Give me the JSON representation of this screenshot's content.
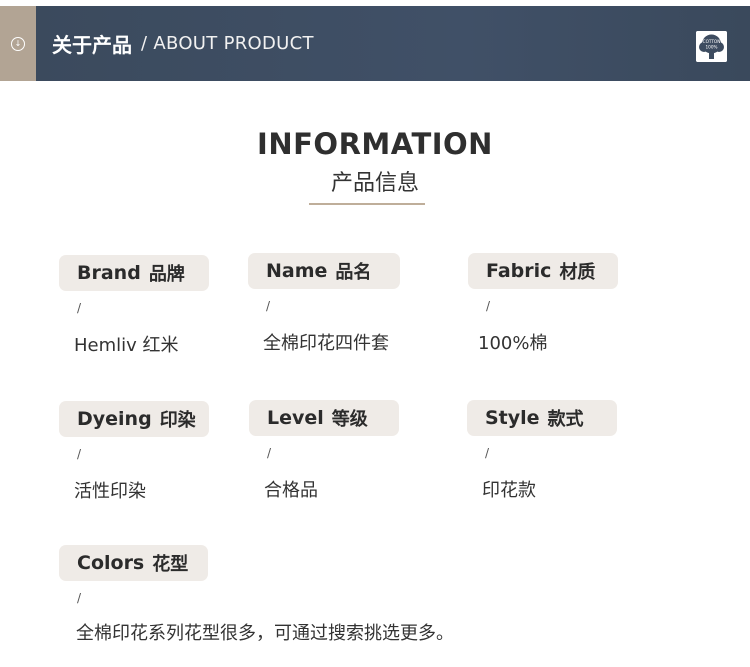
{
  "header": {
    "title": "关于产品",
    "subtitle": "/ ABOUT PRODUCT",
    "badge_text_top": "COTTON",
    "badge_text_bottom": "100%"
  },
  "section": {
    "title": "INFORMATION",
    "subtitle": "产品信息"
  },
  "items": [
    {
      "en": "Brand",
      "cn": "品牌",
      "slash": "/",
      "value": "Hemliv 红米"
    },
    {
      "en": "Name",
      "cn": "品名",
      "slash": "/",
      "value": "全棉印花四件套"
    },
    {
      "en": "Fabric",
      "cn": "材质",
      "slash": "/",
      "value": "100%棉"
    },
    {
      "en": "Dyeing",
      "cn": "印染",
      "slash": "/",
      "value": "活性印染"
    },
    {
      "en": "Level",
      "cn": "等级",
      "slash": "/",
      "value": "合格品"
    },
    {
      "en": "Style",
      "cn": "款式",
      "slash": "/",
      "value": "印花款"
    },
    {
      "en": "Colors",
      "cn": "花型",
      "slash": "/",
      "value": "全棉印花系列花型很多，可通过搜索挑选更多。"
    }
  ],
  "colors": {
    "header_bg": "#3d4c60",
    "tab_bg": "#b2a494",
    "pill_bg": "#efebe7",
    "accent_line": "#bfae9a"
  },
  "icons": {
    "tab": "scroll-down-icon",
    "badge": "cotton-100-icon"
  }
}
